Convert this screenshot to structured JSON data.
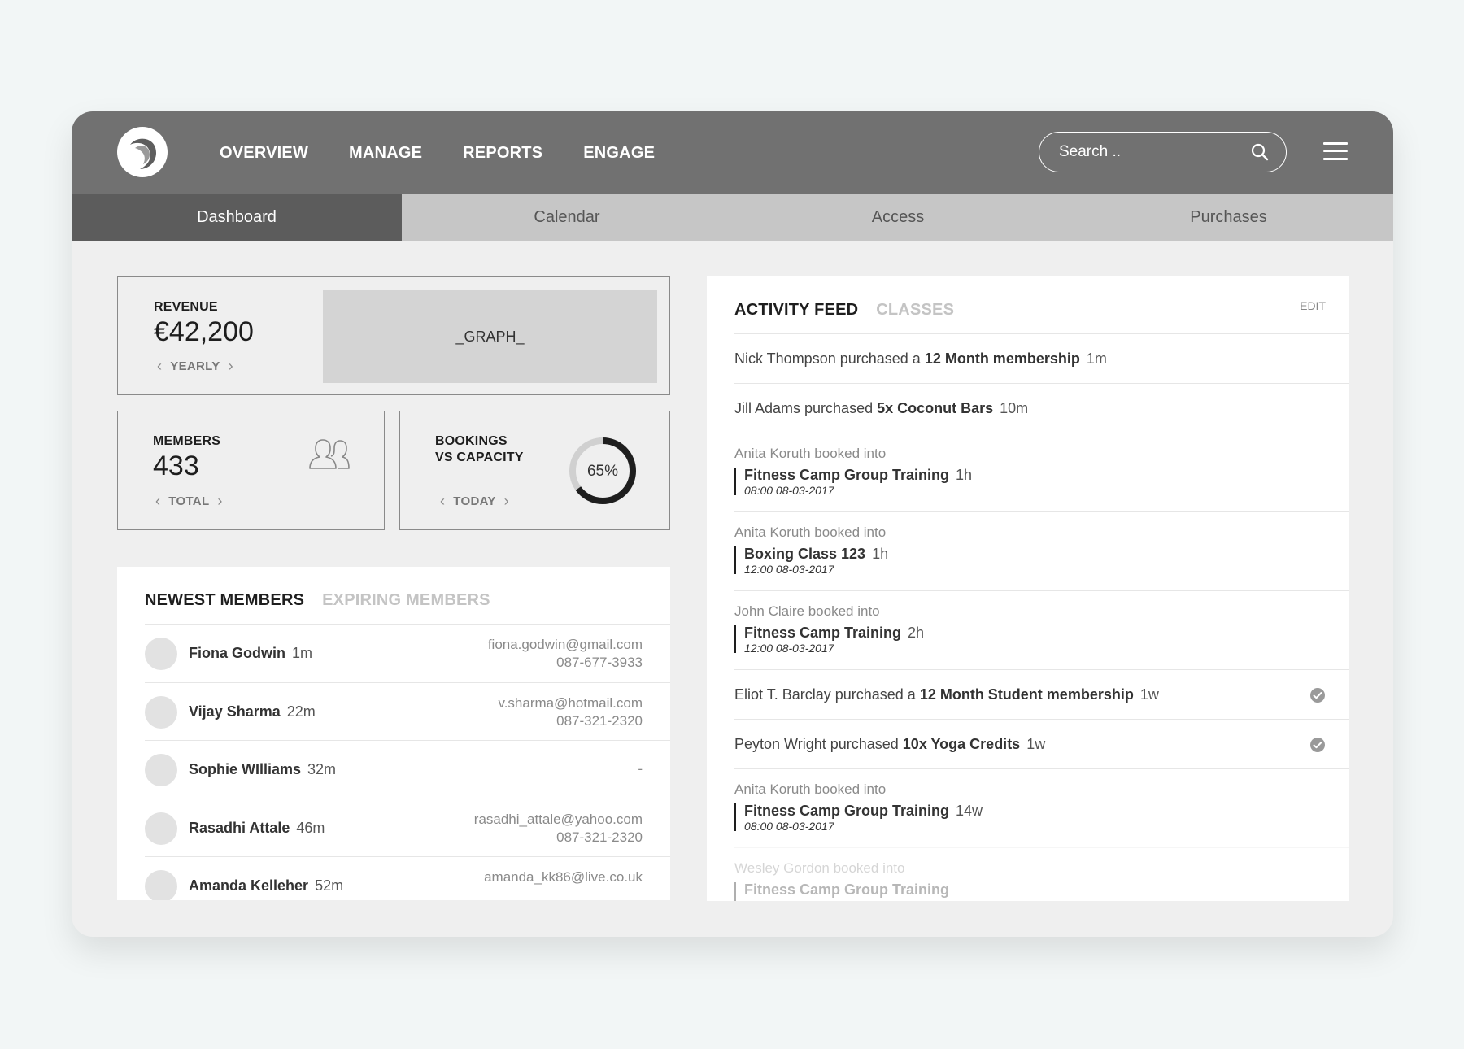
{
  "nav": {
    "items": [
      "OVERVIEW",
      "MANAGE",
      "REPORTS",
      "ENGAGE"
    ],
    "search_placeholder": "Search .."
  },
  "subtabs": [
    "Dashboard",
    "Calendar",
    "Access",
    "Purchases"
  ],
  "revenue": {
    "label": "REVENUE",
    "value": "€42,200",
    "period": "YEARLY",
    "graph_placeholder": "_GRAPH_"
  },
  "members_card": {
    "label": "MEMBERS",
    "value": "433",
    "period": "TOTAL"
  },
  "bookings_card": {
    "label_line1": "BOOKINGS",
    "label_line2": "VS CAPACITY",
    "period": "TODAY",
    "percent_label": "65%",
    "percent": 65
  },
  "newest_members": {
    "tab_active": "NEWEST MEMBERS",
    "tab_inactive": "EXPIRING MEMBERS",
    "rows": [
      {
        "name": "Fiona Godwin",
        "ago": "1m",
        "email": "fiona.godwin@gmail.com",
        "phone": "087-677-3933"
      },
      {
        "name": "Vijay Sharma",
        "ago": "22m",
        "email": "v.sharma@hotmail.com",
        "phone": "087-321-2320"
      },
      {
        "name": "Sophie WIlliams",
        "ago": "32m",
        "email": "-",
        "phone": ""
      },
      {
        "name": "Rasadhi Attale",
        "ago": "46m",
        "email": "rasadhi_attale@yahoo.com",
        "phone": "087-321-2320"
      },
      {
        "name": "Amanda Kelleher",
        "ago": "52m",
        "email": "amanda_kk86@live.co.uk",
        "phone": ""
      }
    ]
  },
  "activity_feed": {
    "tab_active": "ACTIVITY FEED",
    "tab_inactive": "CLASSES",
    "edit_label": "EDIT",
    "items": [
      {
        "type": "purchase",
        "text": "Nick Thompson purchased a",
        "item": "12 Month membership",
        "ago": "1m",
        "checked": false
      },
      {
        "type": "purchase",
        "text": "Jill Adams purchased",
        "item": "5x Coconut Bars",
        "ago": "10m",
        "checked": false
      },
      {
        "type": "booking",
        "who": "Anita Koruth booked into",
        "class": "Fitness Camp Group Training",
        "ago": "1h",
        "when": "08:00 08-03-2017"
      },
      {
        "type": "booking",
        "who": "Anita Koruth booked into",
        "class": "Boxing Class 123",
        "ago": "1h",
        "when": "12:00 08-03-2017"
      },
      {
        "type": "booking",
        "who": "John Claire booked into",
        "class": "Fitness Camp Training",
        "ago": "2h",
        "when": "12:00 08-03-2017"
      },
      {
        "type": "purchase",
        "text": "Eliot T. Barclay purchased a",
        "item": "12 Month Student membership",
        "ago": "1w",
        "checked": true
      },
      {
        "type": "purchase",
        "text": "Peyton Wright purchased",
        "item": "10x Yoga Credits",
        "ago": "1w",
        "checked": true
      },
      {
        "type": "booking",
        "who": "Anita Koruth booked into",
        "class": "Fitness Camp Group Training",
        "ago": "14w",
        "when": "08:00 08-03-2017"
      },
      {
        "type": "booking",
        "who": "Wesley Gordon booked into",
        "class": "Fitness Camp Group Training",
        "ago": "",
        "when": "",
        "faded": true
      }
    ]
  },
  "colors": {
    "topbar": "#717171",
    "subtab_active": "#5c5c5c",
    "subtab_bar": "#c6c6c6",
    "donut_fill": "#1e1e1e",
    "donut_track": "#d0d0d0"
  }
}
